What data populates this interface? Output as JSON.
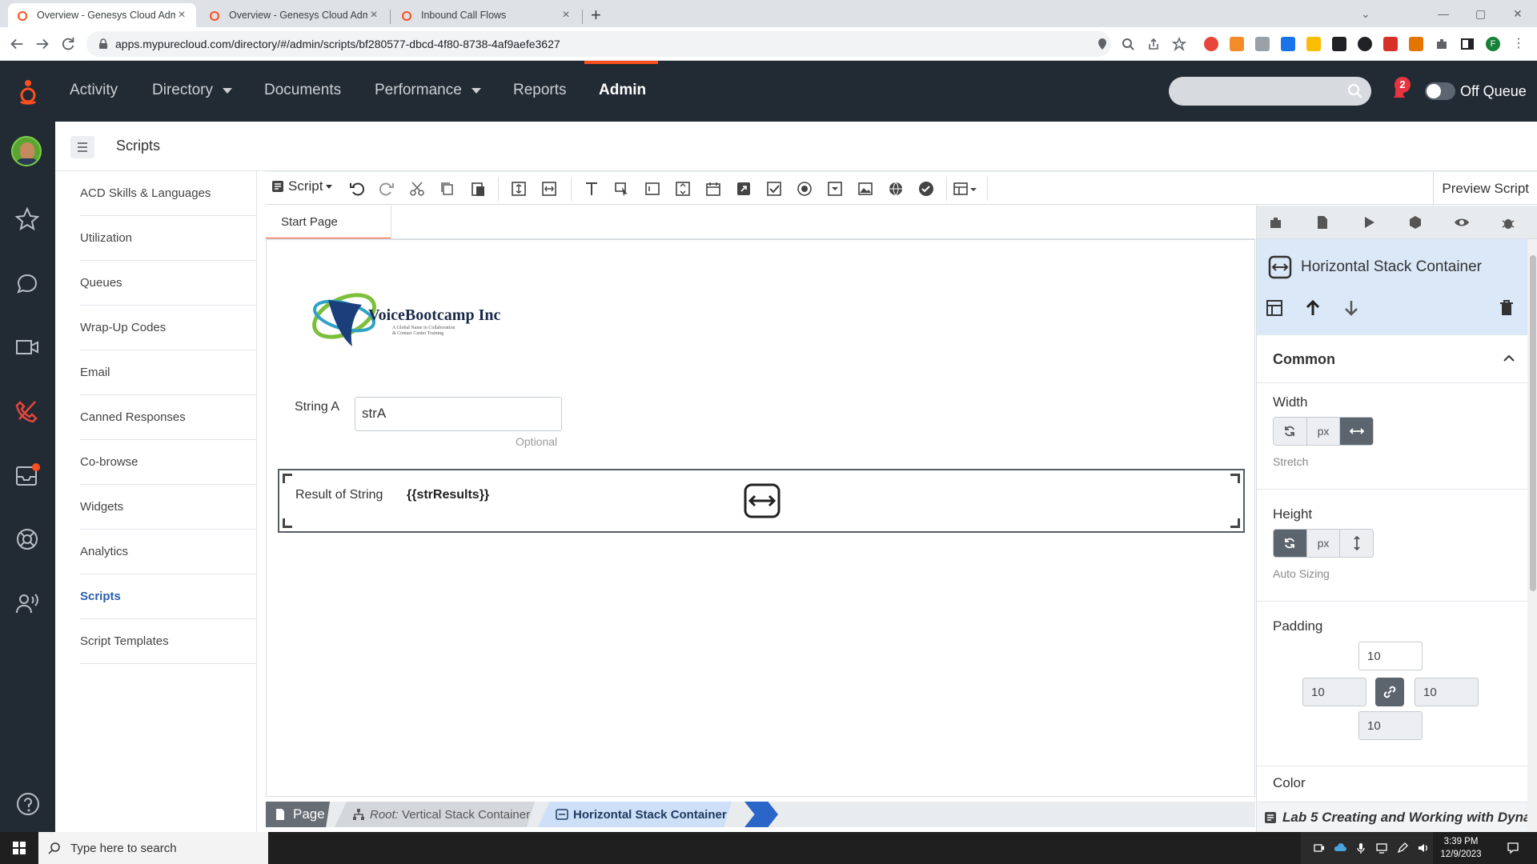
{
  "browser": {
    "tabs": [
      {
        "title": "Overview - Genesys Cloud Admi",
        "active": true
      },
      {
        "title": "Overview - Genesys Cloud Admi",
        "active": false
      },
      {
        "title": "Inbound Call Flows",
        "active": false
      }
    ],
    "url": "apps.mypurecloud.com/directory/#/admin/scripts/bf280577-dbcd-4f80-8738-4af9aefe3627",
    "profile_initial": "F"
  },
  "topnav": {
    "items": [
      {
        "label": "Activity"
      },
      {
        "label": "Directory"
      },
      {
        "label": "Documents"
      },
      {
        "label": "Performance"
      },
      {
        "label": "Reports"
      },
      {
        "label": "Admin"
      }
    ],
    "active": "Admin",
    "notification_count": "2",
    "queue_status": "Off Queue",
    "accent": "#ff4f1f"
  },
  "page": {
    "title": "Scripts"
  },
  "sidemenu": {
    "items": [
      {
        "label": "ACD Skills & Languages"
      },
      {
        "label": "Utilization"
      },
      {
        "label": "Queues"
      },
      {
        "label": "Wrap-Up Codes"
      },
      {
        "label": "Email"
      },
      {
        "label": "Canned Responses"
      },
      {
        "label": "Co-browse"
      },
      {
        "label": "Widgets"
      },
      {
        "label": "Analytics"
      },
      {
        "label": "Scripts"
      },
      {
        "label": "Script Templates"
      }
    ],
    "active": "Scripts"
  },
  "toolbar": {
    "script_label": "Script",
    "preview_label": "Preview Script"
  },
  "canvas": {
    "page_tab": "Start Page",
    "logo_text": "VoiceBootcamp Inc",
    "logo_tagline_1": "A Global Name in Collaboration",
    "logo_tagline_2": "& Contact Center Training",
    "string_a_label": "String A",
    "string_a_value": "strA",
    "string_a_hint": "Optional",
    "result_label": "Result of String",
    "result_value": "{{strResults}}"
  },
  "breadcrumb": {
    "page": "Page",
    "root_prefix": "Root:",
    "root": "Vertical Stack Container",
    "current": "Horizontal Stack Container"
  },
  "properties": {
    "title": "Horizontal Stack Container",
    "section": "Common",
    "width_label": "Width",
    "width_mode": "Stretch",
    "height_label": "Height",
    "height_mode": "Auto Sizing",
    "unit_label": "px",
    "padding_label": "Padding",
    "padding_top": "10",
    "padding_left": "10",
    "padding_right": "10",
    "padding_bottom": "10",
    "color_label": "Color",
    "lab_title": "Lab 5 Creating and Working with Dyna..."
  },
  "taskbar": {
    "search_placeholder": "Type here to search",
    "time": "3:39 PM",
    "date": "12/9/2023"
  }
}
